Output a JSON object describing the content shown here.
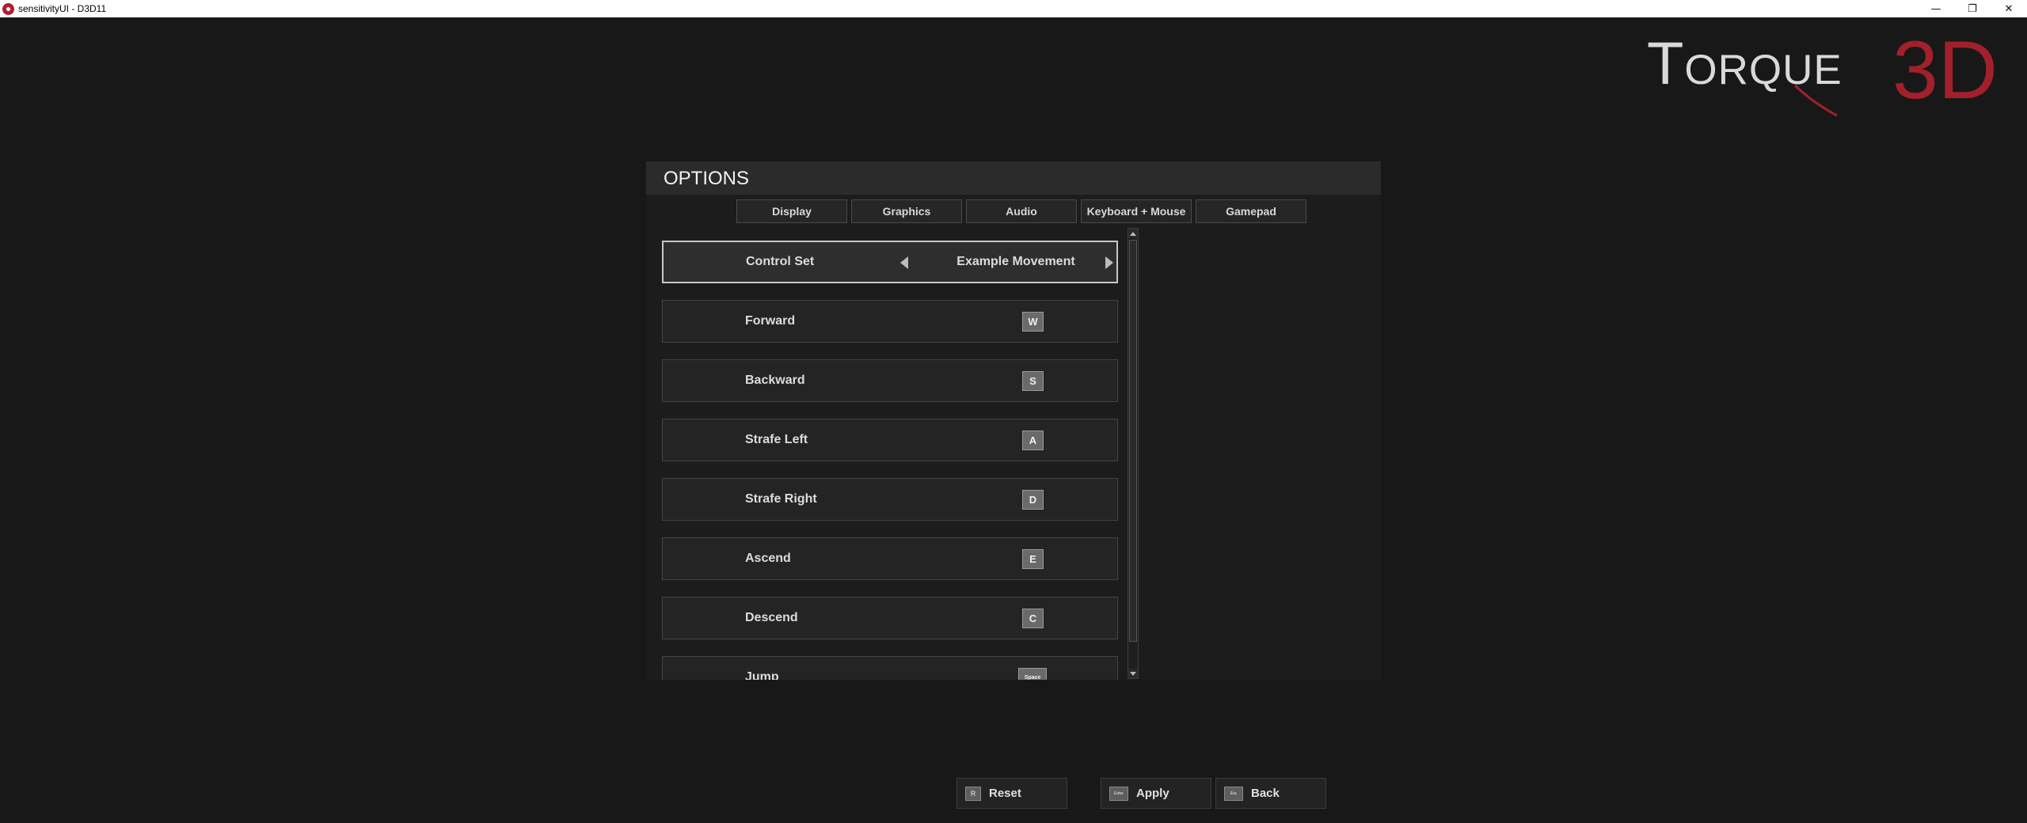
{
  "window": {
    "title": "sensitivityUI - D3D11",
    "minimize": "—",
    "restore": "❐",
    "close": "✕"
  },
  "logo": {
    "word": "Torque",
    "suffix": "3D"
  },
  "options": {
    "title": "OPTIONS",
    "tabs": [
      "Display",
      "Graphics",
      "Audio",
      "Keyboard + Mouse",
      "Gamepad"
    ],
    "control_set": {
      "label": "Control Set",
      "value": "Example Movement"
    },
    "bindings": [
      {
        "label": "Forward",
        "key": "W"
      },
      {
        "label": "Backward",
        "key": "S"
      },
      {
        "label": "Strafe Left",
        "key": "A"
      },
      {
        "label": "Strafe Right",
        "key": "D"
      },
      {
        "label": "Ascend",
        "key": "E"
      },
      {
        "label": "Descend",
        "key": "C"
      },
      {
        "label": "Jump",
        "key": "Space"
      }
    ]
  },
  "footer": {
    "reset": {
      "key": "R",
      "label": "Reset"
    },
    "apply": {
      "key": "Enter",
      "label": "Apply"
    },
    "back": {
      "key": "Esc",
      "label": "Back"
    }
  },
  "colors": {
    "background": "#181818",
    "accent": "#a2202b"
  }
}
